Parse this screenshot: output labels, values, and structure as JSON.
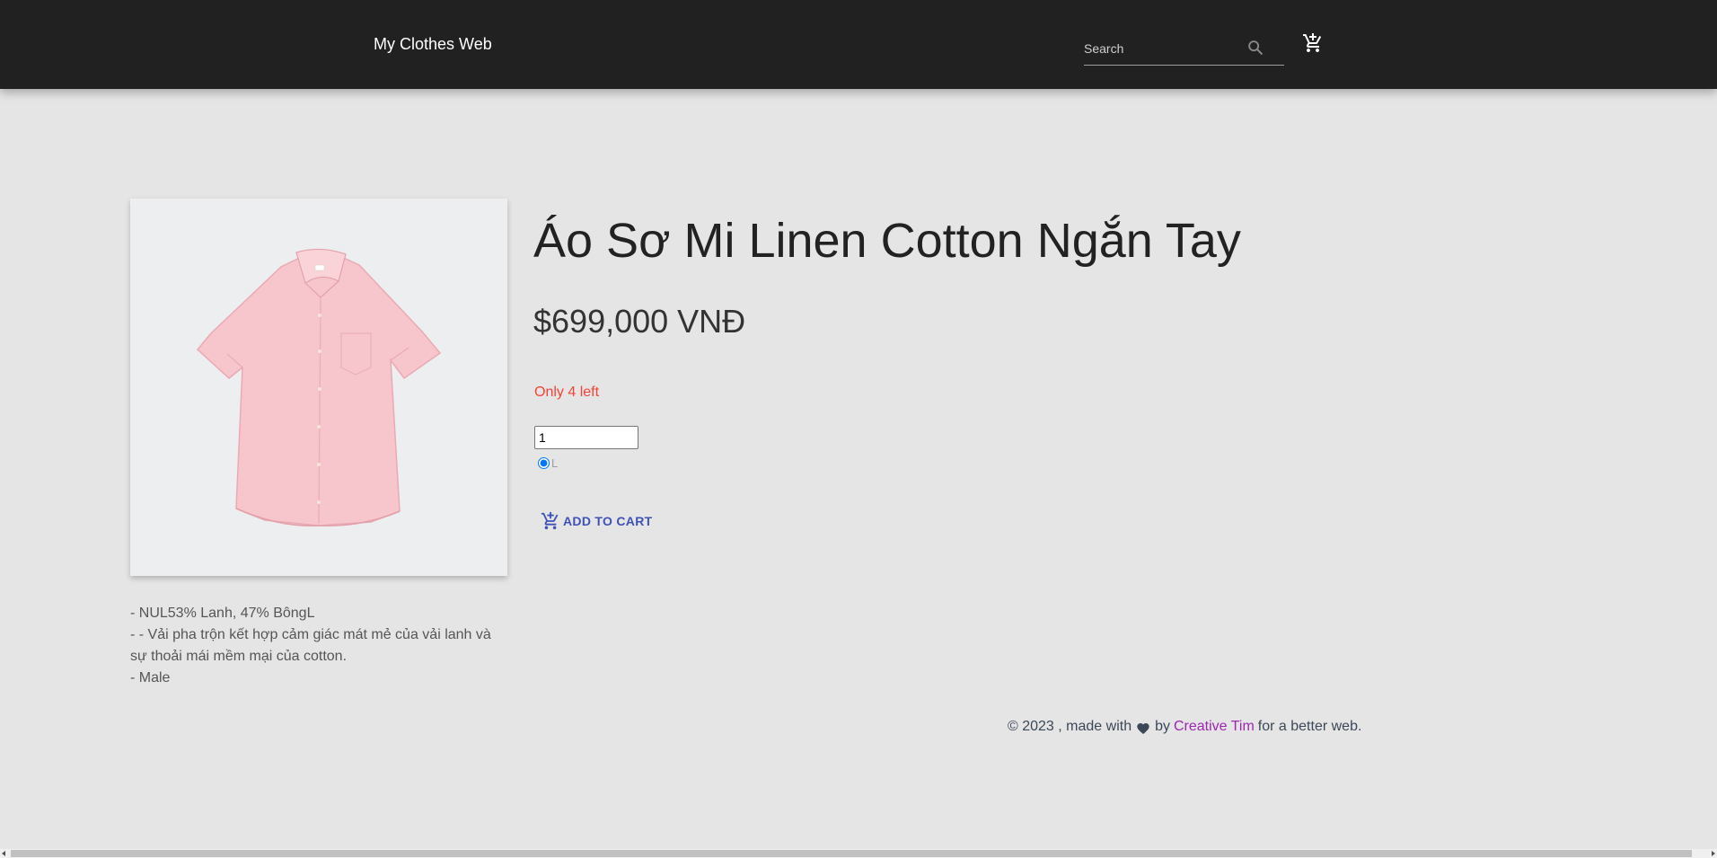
{
  "nav": {
    "brand": "My Clothes Web",
    "search_placeholder": "Search"
  },
  "product": {
    "title": "Áo Sơ Mi Linen Cotton Ngắn Tay",
    "price": "$699,000 VNĐ",
    "stock": "Only 4 left",
    "quantity": "1",
    "size": "L",
    "add_to_cart": "ADD TO CART",
    "description": [
      "- NUL53% Lanh, 47% BôngL",
      "- - Vải pha trộn kết hợp cảm giác mát mẻ của vải lanh và sự thoải mái mềm mại của cotton.",
      "- Male"
    ]
  },
  "footer": {
    "prefix": "© 2023 , made with",
    "by": "by",
    "link": "Creative Tim",
    "suffix": "for a better web."
  },
  "colors": {
    "navbar": "#212121",
    "stock": "#f44336",
    "button": "#3f51b5",
    "link": "#9c27b0",
    "shirt": "#f7c6cc"
  }
}
